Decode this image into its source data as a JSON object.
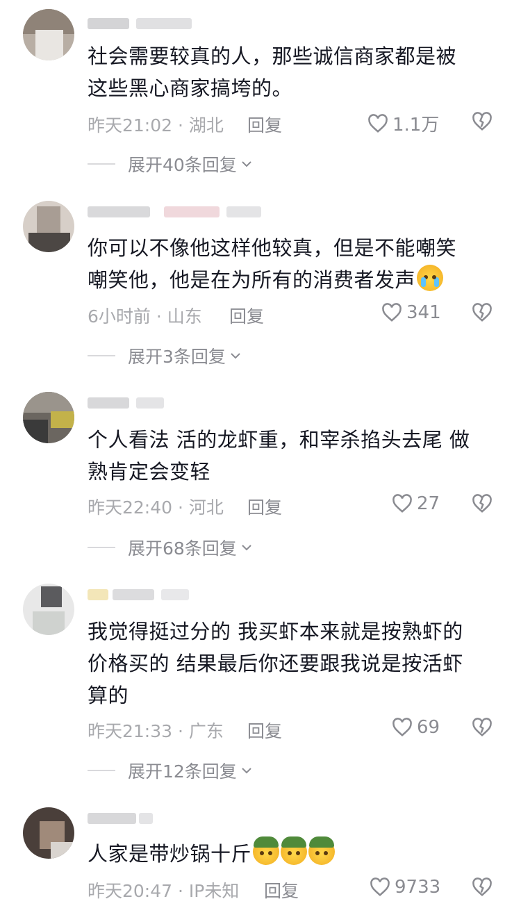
{
  "comments": [
    {
      "text_lines": [
        "社会需要较真的人，那些诚信商家都是被",
        "这些黑心商家搞垮的。"
      ],
      "time_location": "昨天21:02 · 湖北",
      "reply_label": "回复",
      "like_count": "1.1万",
      "expand_label": "展开40条回复"
    },
    {
      "text_lines": [
        "你可以不像他这样他较真，但是不能嘲笑",
        "嘲笑他，他是在为所有的消费者发声"
      ],
      "emoji": [
        "crying-face-emoji"
      ],
      "time_location": "6小时前 · 山东",
      "reply_label": "回复",
      "like_count": "341",
      "expand_label": "展开3条回复"
    },
    {
      "text_lines": [
        "个人看法 活的龙虾重，和宰杀掐头去尾 做",
        "熟肯定会变轻"
      ],
      "time_location": "昨天22:40 · 河北",
      "reply_label": "回复",
      "like_count": "27",
      "expand_label": "展开68条回复"
    },
    {
      "text_lines": [
        "我觉得挺过分的 我买虾本来就是按熟虾的",
        "价格买的 结果最后你还要跟我说是按活虾",
        "算的"
      ],
      "time_location": "昨天21:33 · 广东",
      "reply_label": "回复",
      "like_count": "69",
      "expand_label": "展开12条回复"
    },
    {
      "text_lines": [
        "人家是带炒锅十斤"
      ],
      "emoji": [
        "helmet-face-emoji",
        "helmet-face-emoji",
        "helmet-face-emoji"
      ],
      "time_location": "昨天20:47 · IP未知",
      "reply_label": "回复",
      "like_count": "9733"
    }
  ],
  "icons": {
    "like": "heart-outline-icon",
    "dislike": "broken-heart-icon",
    "expand": "chevron-down-icon"
  },
  "colors": {
    "text": "#161823",
    "meta": "#a8a9ad",
    "secondary": "#8a8b91"
  }
}
